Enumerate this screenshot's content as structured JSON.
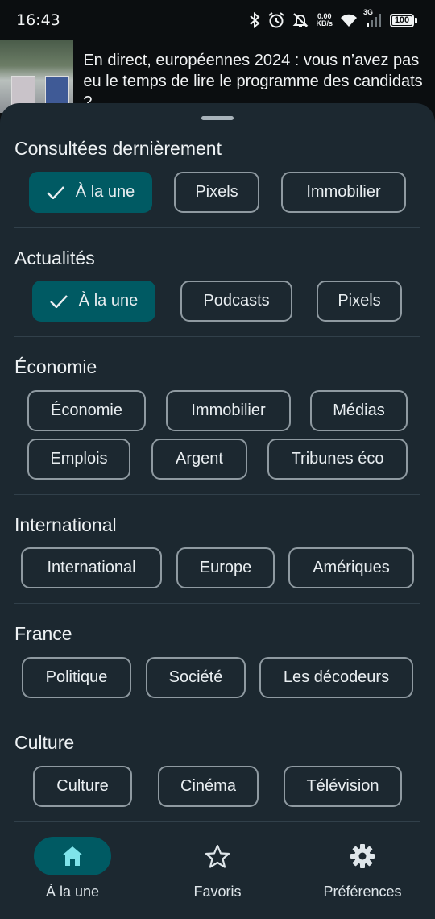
{
  "status_bar": {
    "time": "16:43",
    "net_speed_value": "0.00",
    "net_speed_unit": "KB/s",
    "network_type": "3G",
    "battery_level": "100",
    "icons": [
      "bluetooth-icon",
      "alarm-icon",
      "bell-off-icon",
      "wifi-icon",
      "signal-icon",
      "battery-icon"
    ]
  },
  "article": {
    "title": "En direct, européennes 2024 : vous n’avez pas eu le temps de lire le programme des candidats ?"
  },
  "sections": [
    {
      "title": "Consultées dernièrement",
      "chips": [
        {
          "label": "À la une",
          "selected": true
        },
        {
          "label": "Pixels",
          "selected": false
        },
        {
          "label": "Immobilier",
          "selected": false
        }
      ]
    },
    {
      "title": "Actualités",
      "chips": [
        {
          "label": "À la une",
          "selected": true
        },
        {
          "label": "Podcasts",
          "selected": false
        },
        {
          "label": "Pixels",
          "selected": false
        }
      ]
    },
    {
      "title": "Économie",
      "chips": [
        {
          "label": "Économie",
          "selected": false
        },
        {
          "label": "Immobilier",
          "selected": false
        },
        {
          "label": "Médias",
          "selected": false
        },
        {
          "label": "Emplois",
          "selected": false
        },
        {
          "label": "Argent",
          "selected": false
        },
        {
          "label": "Tribunes éco",
          "selected": false
        }
      ]
    },
    {
      "title": "International",
      "chips": [
        {
          "label": "International",
          "selected": false
        },
        {
          "label": "Europe",
          "selected": false
        },
        {
          "label": "Amériques",
          "selected": false
        }
      ]
    },
    {
      "title": "France",
      "chips": [
        {
          "label": "Politique",
          "selected": false
        },
        {
          "label": "Société",
          "selected": false
        },
        {
          "label": "Les décodeurs",
          "selected": false
        }
      ]
    },
    {
      "title": "Culture",
      "chips": [
        {
          "label": "Culture",
          "selected": false
        },
        {
          "label": "Cinéma",
          "selected": false
        },
        {
          "label": "Télévision",
          "selected": false
        }
      ]
    }
  ],
  "bottom_nav": {
    "items": [
      {
        "label": "À la une",
        "icon": "home-icon",
        "active": true
      },
      {
        "label": "Favoris",
        "icon": "star-icon",
        "active": false
      },
      {
        "label": "Préférences",
        "icon": "gear-icon",
        "active": false
      }
    ]
  },
  "colors": {
    "sheet_background": "#1c2830",
    "selected_chip": "#005a63",
    "chip_border": "#8f9aa1",
    "nav_active_icon": "#7fe3ea"
  }
}
